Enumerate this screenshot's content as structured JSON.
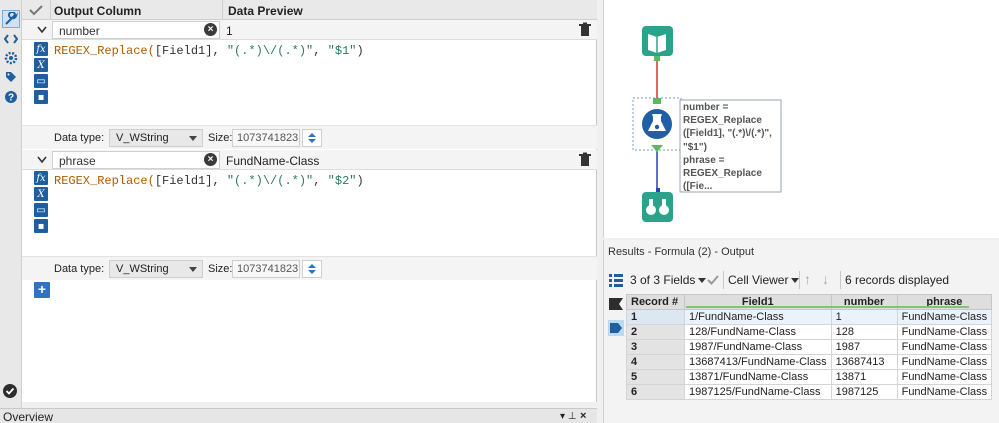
{
  "formula": {
    "headers": {
      "output_column": "Output Column",
      "data_preview": "Data Preview"
    },
    "rows": [
      {
        "name": "number",
        "preview": "1",
        "expression_func": "REGEX_Replace(",
        "expression_field": "[Field1]",
        "expression_pattern": "\"(.*)\\/(.*)\"",
        "expression_replace": "\"$1\"",
        "data_type_label": "Data type:",
        "data_type": "V_WString",
        "size_label": "Size:",
        "size": "1073741823"
      },
      {
        "name": "phrase",
        "preview": "FundName-Class",
        "expression_func": "REGEX_Replace(",
        "expression_field": "[Field1]",
        "expression_pattern": "\"(.*)\\/(.*)\"",
        "expression_replace": "\"$2\"",
        "data_type_label": "Data type:",
        "data_type": "V_WString",
        "size_label": "Size:",
        "size": "1073741823"
      }
    ],
    "add_label": "+"
  },
  "overview": {
    "title": "Overview",
    "pin": "▾ ⊥",
    "close": "×"
  },
  "canvas": {
    "annotation_lines": [
      "number =",
      "REGEX_Replace",
      "([Field1], \"(.*)\\/(.*)\",",
      "\"$1\")",
      "phrase =",
      "REGEX_Replace",
      "([Fie..."
    ],
    "colors": {
      "input_tool": "#2aa38a",
      "formula_tool": "#1f5fa6",
      "browse_tool": "#2aa38a",
      "red_wire": "#d93030",
      "blue_wire": "#2b3fbf"
    }
  },
  "results": {
    "title": "Results - Formula (2) - Output",
    "fields_label": "3 of 3 Fields",
    "cell_viewer_label": "Cell Viewer",
    "records_label": "6 records displayed",
    "columns": [
      "Record #",
      "Field1",
      "number",
      "phrase"
    ],
    "rows": [
      [
        "1",
        "1/FundName-Class",
        "1",
        "FundName-Class"
      ],
      [
        "2",
        "128/FundName-Class",
        "128",
        "FundName-Class"
      ],
      [
        "3",
        "1987/FundName-Class",
        "1987",
        "FundName-Class"
      ],
      [
        "4",
        "13687413/FundName-Class",
        "13687413",
        "FundName-Class"
      ],
      [
        "5",
        "13871/FundName-Class",
        "13871",
        "FundName-Class"
      ],
      [
        "6",
        "1987125/FundName-Class",
        "1987125",
        "FundName-Class"
      ]
    ]
  }
}
